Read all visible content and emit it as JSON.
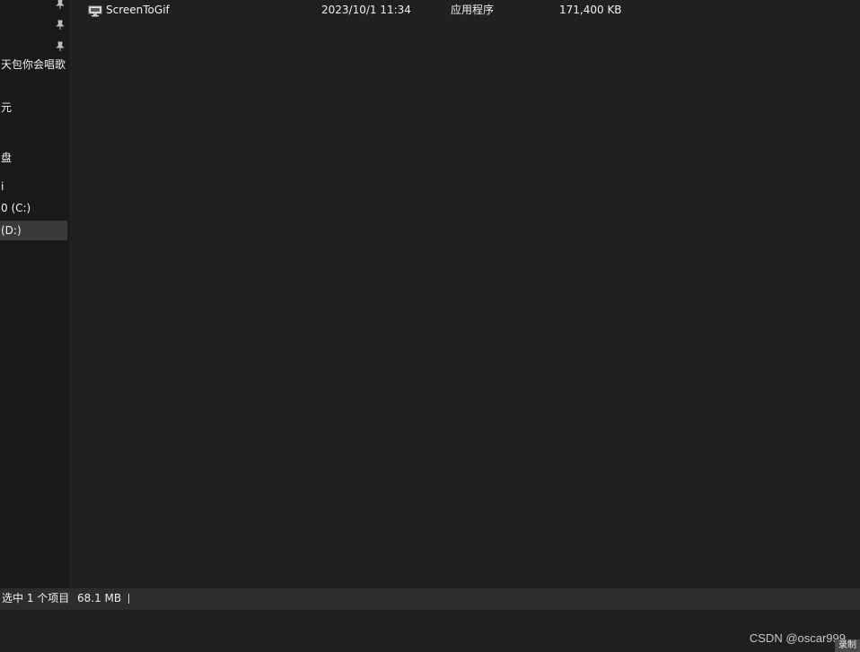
{
  "sidebar": {
    "items": [
      {
        "label": "天包你会唱歌"
      },
      {
        "label": "元"
      },
      {
        "label": "盘"
      },
      {
        "label": "i"
      },
      {
        "label": "0 (C:)"
      },
      {
        "label": "(D:)"
      }
    ]
  },
  "file_list": {
    "rows": [
      {
        "icon": "monitor-app-icon",
        "name": "ScreenToGif",
        "date_modified": "2023/10/1 11:34",
        "type": "应用程序",
        "size": "171,400 KB"
      }
    ]
  },
  "statusbar": {
    "selected_text": "选中 1 个项目",
    "size_text": "68.1 MB"
  },
  "watermark": {
    "text": "CSDN @oscar999",
    "chip": "录制"
  },
  "colors": {
    "background": "#202020",
    "sidebar": "#191919",
    "selected": "#3a3a3a",
    "statusbar": "#2d2d2d"
  }
}
